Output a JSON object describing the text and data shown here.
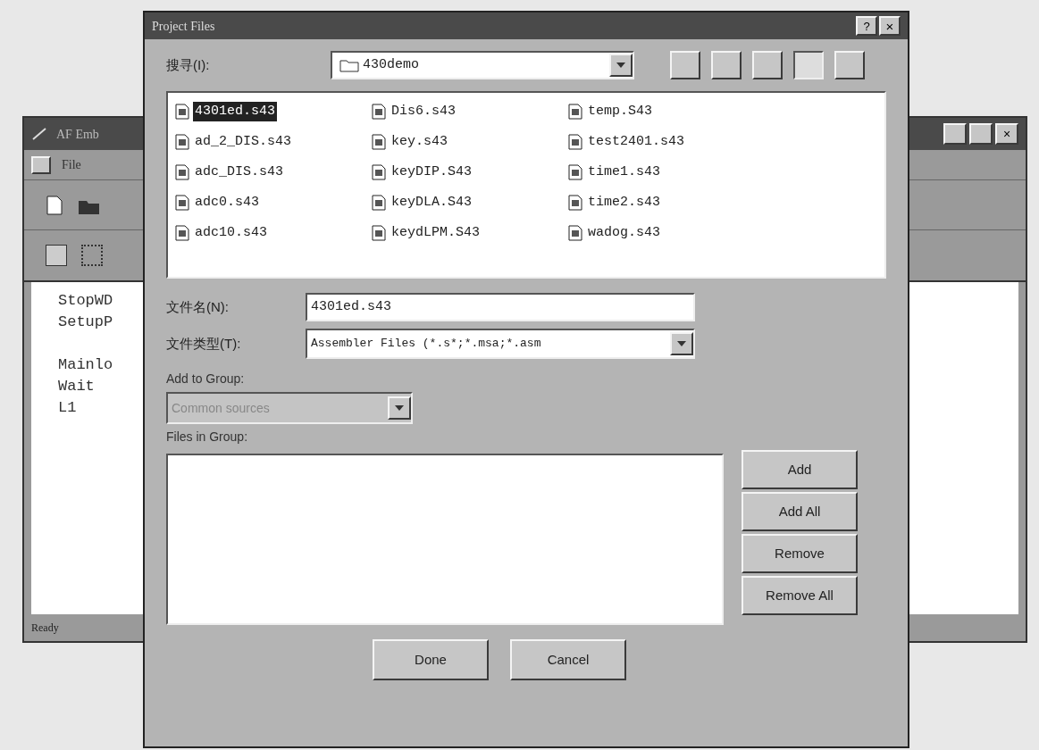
{
  "background_window": {
    "title": "AF Emb",
    "menu": [
      "File"
    ],
    "close": "×",
    "code_blocks": [
      [
        "StopWD",
        "SetupP"
      ],
      [
        "Mainlo",
        "Wait",
        "L1"
      ]
    ],
    "status_bar": "Ready"
  },
  "dialog": {
    "title": "Project Files",
    "help": "?",
    "close": "×",
    "look_in": {
      "label": "搜寻(I):",
      "value": "430demo"
    },
    "files": [
      {
        "name": "4301ed.s43",
        "selected": true
      },
      {
        "name": "ad_2_DIS.s43",
        "selected": false
      },
      {
        "name": "adc_DIS.s43",
        "selected": false
      },
      {
        "name": "adc0.s43",
        "selected": false
      },
      {
        "name": "adc10.s43",
        "selected": false
      },
      {
        "name": "Dis6.s43",
        "selected": false
      },
      {
        "name": "key.s43",
        "selected": false
      },
      {
        "name": "keyDIP.S43",
        "selected": false
      },
      {
        "name": "keyDLA.S43",
        "selected": false
      },
      {
        "name": "keydLPM.S43",
        "selected": false
      },
      {
        "name": "temp.S43",
        "selected": false
      },
      {
        "name": "test2401.s43",
        "selected": false
      },
      {
        "name": "time1.s43",
        "selected": false
      },
      {
        "name": "time2.s43",
        "selected": false
      },
      {
        "name": "wadog.s43",
        "selected": false
      }
    ],
    "file_name": {
      "label": "文件名(N):",
      "value": "4301ed.s43"
    },
    "file_type": {
      "label": "文件类型(T):",
      "value": "Assembler Files (*.s*;*.msa;*.asm"
    },
    "add_to_group": {
      "label": "Add to Group:",
      "value": "Common sources",
      "disabled": true
    },
    "files_in_group": {
      "label": "Files in Group:"
    },
    "side_buttons": [
      "Add",
      "Add All",
      "Remove",
      "Remove All"
    ],
    "bottom_buttons": [
      "Done",
      "Cancel"
    ]
  }
}
